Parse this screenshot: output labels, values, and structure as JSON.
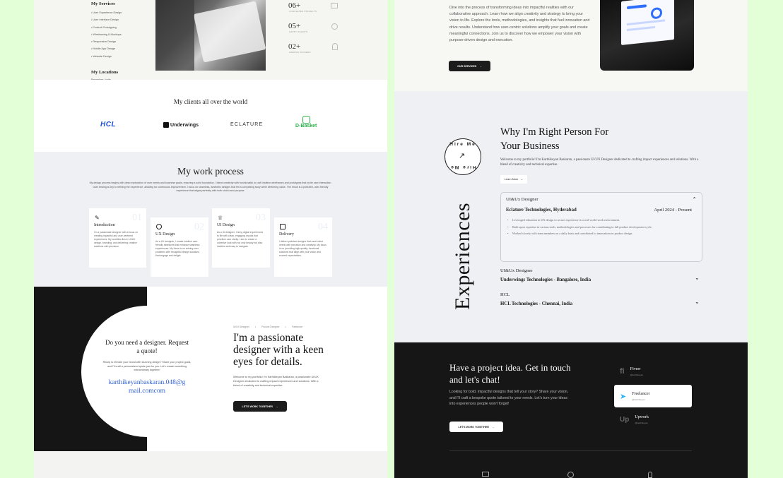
{
  "left": {
    "services": {
      "title": "My Services",
      "items": [
        "User Experience Design",
        "User Interface Design",
        "Product Prototyping",
        "Wireframing & Mockups",
        "Responsive Design",
        "Mobile App Design",
        "Website Design"
      ]
    },
    "locations": {
      "title": "My Locations",
      "value": "Bangalore, India"
    },
    "stats": [
      {
        "num": "06+",
        "label": "COMPLETED PROJECTS"
      },
      {
        "num": "05+",
        "label": "HAPPY CLIENTS"
      },
      {
        "num": "02+",
        "label": "AWARDS WINNERS"
      }
    ],
    "clients": {
      "title": "My clients all over the world",
      "logos": [
        "HCL",
        "Underwings",
        "ECLATURE",
        "D-Basket"
      ]
    },
    "process": {
      "title": "My work process",
      "description": "My design process begins with deep exploration of user needs and business goals, ensuring a solid foundation. I blend creativity with functionality to craft intuitive wireframes and prototypes that invite user interaction. User testing is key to refining the experience, allowing for continuous improvement. I focus on seamless, aesthetic designs that tell a compelling story while delivering value. The result is a polished, user-friendly experience that aligns perfectly with both vision and purpose.",
      "steps": [
        {
          "num": "01",
          "title": "Introduction",
          "text": "I'm a passionate designer with a focus on creating impactful and user-centered experiences. My workflow lies in UI/UX design, branding, and delivering creative solutions with precision."
        },
        {
          "num": "02",
          "title": "UX Design",
          "text": "As a UX designer, I create intuitive user-friendly interfaces that enhance seamless experiences. My focus is on solving user problems with thoughtful design solutions that engage and delight."
        },
        {
          "num": "03",
          "title": "UI Design",
          "text": "As a UI designer, I bring digital experiences to life with clean, engaging visuals that prioritize user clarity. I aim to create a cohesive look with not only beauty but also intuitive and easy to navigate."
        },
        {
          "num": "04",
          "title": "Delivery",
          "text": "I deliver polished designs that meet client needs with precision and creativity. My focus is on providing high-quality, functional solutions that align with your vision and exceed expectations."
        }
      ]
    },
    "quote": {
      "title": "Do you need a designer. Request a quote!",
      "text": "Ready to elevate your brand with stunning design? Share your project goals, and I'll craft a personalized quote just for you. Let's create something extraordinary together!",
      "email": "karthikeyanbaskaran.048@gmail.comcom"
    },
    "passion": {
      "tags": [
        "UI/UX Designer",
        "Product Designer",
        "Freelancer"
      ],
      "heading": "I'm a passionate designer with a keen eyes for details.",
      "text": "Welcome to my portfolio! I'm Karthikeyan Baskaran, a passionate UI/UX Designer dedicated to crafting impact experiences and solutions. With a blend of creativity and technical expertise.",
      "button": "LET'S WORK TOGETHER"
    }
  },
  "right": {
    "about": {
      "text": "Dive into the process of transforming ideas into impactful realities with our collaborative approach. Learn how we align creativity and strategy to bring your vision to life. Explore the tools, methodologies, and insights that fuel innovation and drive results. Understand how user-centric solutions amplify your goals and create meaningful connections. Join us to discover how we empower your vision with purpose-driven design and execution.",
      "button": "OUR SERVICES"
    },
    "why": {
      "heading": "Why I'm Right Person For Your Business",
      "badge": "Hire Me",
      "text": "Welcome to my portfolio! I'm Karthikeyan Baskaran, a passionate UI/UX Designer dedicated to crafting impact experiences and solutions. With a blend of creativity and technical expertise.",
      "link": "Learn More"
    },
    "experiences": {
      "title": "Experiences",
      "items": [
        {
          "role": "UI&Ux Designer",
          "company": "Eclature Technologies, Hyderabad",
          "date": "April 2024 - Present",
          "bullets": [
            "Leveraged education in UX design to secure experience in a real-world work environment.",
            "Built upon expertise in various tools, methodologies and processes for contributing to full product development cycle.",
            "Worked closely with team members on a daily basis and contributed to innovations in product design."
          ]
        },
        {
          "role": "UI&Ux Designer",
          "company": "Underwings Technologies - Bangalore, India"
        },
        {
          "role": "HCL",
          "company": "HCL Technologies - Chennai, India"
        }
      ]
    },
    "contact": {
      "heading": "Have a project idea. Get in touch and let's chat!",
      "text": "Looking for bold, impactful designs that tell your story? Share your vision, and I'll craft a bespoke quote tailored to your needs. Let's turn your ideas into experiences people won't forget!",
      "button": "LET'S WORK TOGETHER",
      "platforms": [
        {
          "name": "Fiverr",
          "handle": "@karthikeyan"
        },
        {
          "name": "Freelancer",
          "handle": "@karthikeyan"
        },
        {
          "name": "Upwork",
          "handle": "@karthikeyan"
        }
      ]
    }
  }
}
